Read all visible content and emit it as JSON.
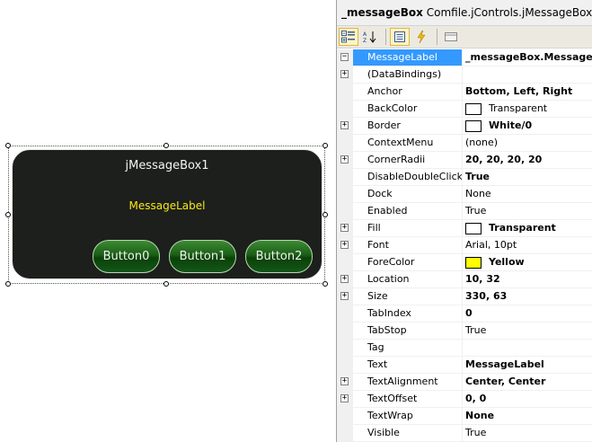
{
  "designer": {
    "message_box": {
      "title": "jMessageBox1",
      "label": "MessageLabel",
      "buttons": [
        "Button0",
        "Button1",
        "Button2"
      ]
    }
  },
  "property_grid": {
    "object_name": "_messageBox",
    "object_type": "Comfile.jControls.jMessageBox",
    "toolbar": [
      "categorized-icon",
      "alphabetical-icon",
      "properties-icon",
      "events-icon",
      "property-pages-icon"
    ],
    "rows": [
      {
        "name": "MessageLabel",
        "value": "_messageBox.MessageLabel",
        "bold": true,
        "expander": "minus",
        "selected": true
      },
      {
        "name": "(DataBindings)",
        "value": "",
        "bold": false,
        "expander": "plus"
      },
      {
        "name": "Anchor",
        "value": "Bottom, Left, Right",
        "bold": true
      },
      {
        "name": "BackColor",
        "value": "Transparent",
        "bold": false,
        "swatch": "#ffffff"
      },
      {
        "name": "Border",
        "value": "White/0",
        "bold": true,
        "expander": "plus",
        "swatch": "#ffffff"
      },
      {
        "name": "ContextMenu",
        "value": "(none)",
        "bold": false
      },
      {
        "name": "CornerRadii",
        "value": "20, 20, 20, 20",
        "bold": true,
        "expander": "plus"
      },
      {
        "name": "DisableDoubleClick",
        "value": "True",
        "bold": true
      },
      {
        "name": "Dock",
        "value": "None",
        "bold": false
      },
      {
        "name": "Enabled",
        "value": "True",
        "bold": false
      },
      {
        "name": "Fill",
        "value": "Transparent",
        "bold": true,
        "expander": "plus",
        "swatch": "#ffffff"
      },
      {
        "name": "Font",
        "value": "Arial, 10pt",
        "bold": false,
        "expander": "plus"
      },
      {
        "name": "ForeColor",
        "value": "Yellow",
        "bold": true,
        "swatch": "#ffff00"
      },
      {
        "name": "Location",
        "value": "10, 32",
        "bold": true,
        "expander": "plus"
      },
      {
        "name": "Size",
        "value": "330, 63",
        "bold": true,
        "expander": "plus"
      },
      {
        "name": "TabIndex",
        "value": "0",
        "bold": true
      },
      {
        "name": "TabStop",
        "value": "True",
        "bold": false
      },
      {
        "name": "Tag",
        "value": "",
        "bold": false
      },
      {
        "name": "Text",
        "value": "MessageLabel",
        "bold": true
      },
      {
        "name": "TextAlignment",
        "value": "Center, Center",
        "bold": true,
        "expander": "plus"
      },
      {
        "name": "TextOffset",
        "value": "0, 0",
        "bold": true,
        "expander": "plus"
      },
      {
        "name": "TextWrap",
        "value": "None",
        "bold": true
      },
      {
        "name": "Visible",
        "value": "True",
        "bold": false
      }
    ]
  },
  "colors": {
    "selection": "#3399ff",
    "message_box_background": "#1c1f1b",
    "label_text": "#f7e81a",
    "button_green": "#1a5e16"
  }
}
